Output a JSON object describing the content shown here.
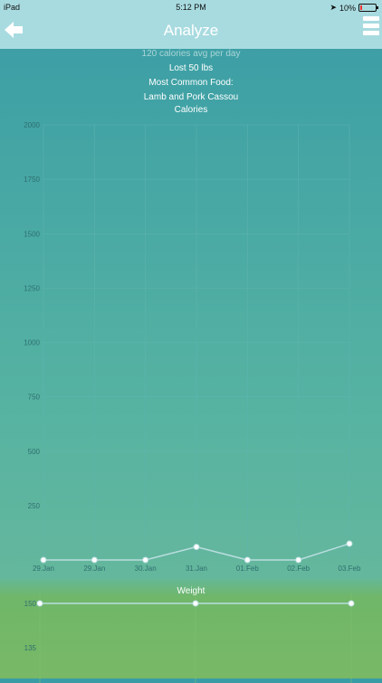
{
  "status_bar": {
    "device": "iPad",
    "time": "5:12 PM",
    "battery": "10%",
    "battery_level": 0.1
  },
  "nav": {
    "title": "Analyze",
    "back_icon": "arrow-left-icon",
    "menu_icon": "hamburger-menu-icon"
  },
  "stats": {
    "avg_line": "120 calories avg per day",
    "lost_line": "Lost 50 lbs",
    "common_food_label": "Most Common Food:",
    "common_food_value": "Lamb and Pork Cassou"
  },
  "colors": {
    "line": "#b9dde0",
    "grid": "#5eb4b0"
  },
  "chart_data": [
    {
      "type": "line",
      "title": "Calories",
      "x": [
        "29.Jan",
        "29.Jan",
        "30.Jan",
        "31.Jan",
        "01.Feb",
        "02.Feb",
        "03.Feb"
      ],
      "values": [
        0,
        0,
        0,
        60,
        0,
        0,
        75
      ],
      "ylim": [
        0,
        2000
      ],
      "yticks": [
        2000,
        1750,
        1500,
        1250,
        1000,
        750,
        500,
        250
      ],
      "grid": true
    },
    {
      "type": "line",
      "title": "Weight",
      "values": [
        150,
        150,
        150
      ],
      "yticks": [
        150,
        135
      ],
      "grid": true
    }
  ]
}
